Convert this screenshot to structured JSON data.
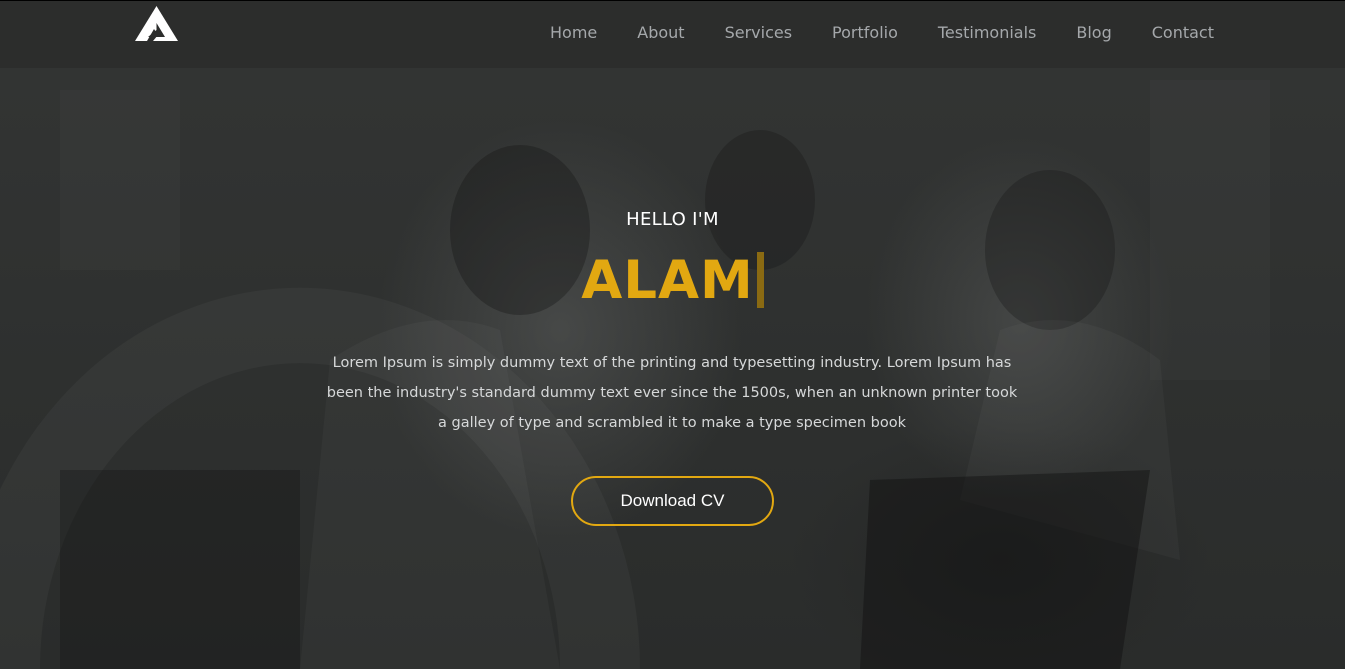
{
  "brand": {
    "logo_icon": "triangle-a-logo-icon"
  },
  "nav": {
    "items": [
      {
        "label": "Home"
      },
      {
        "label": "About"
      },
      {
        "label": "Services"
      },
      {
        "label": "Portfolio"
      },
      {
        "label": "Testimonials"
      },
      {
        "label": "Blog"
      },
      {
        "label": "Contact"
      }
    ]
  },
  "hero": {
    "greeting": "HELLO I'M",
    "name": "ALAM",
    "intro": "Lorem Ipsum is simply dummy text of the printing and typesetting industry. Lorem Ipsum has been the industry's standard dummy text ever since the 1500s, when an unknown printer took a galley of type and scrambled it to make a type specimen book",
    "cta_label": "Download CV"
  },
  "colors": {
    "accent": "#e2a811",
    "background": "#2c2e2d",
    "nav_text": "#a5a8ab",
    "body_text": "#d6d8d9"
  }
}
